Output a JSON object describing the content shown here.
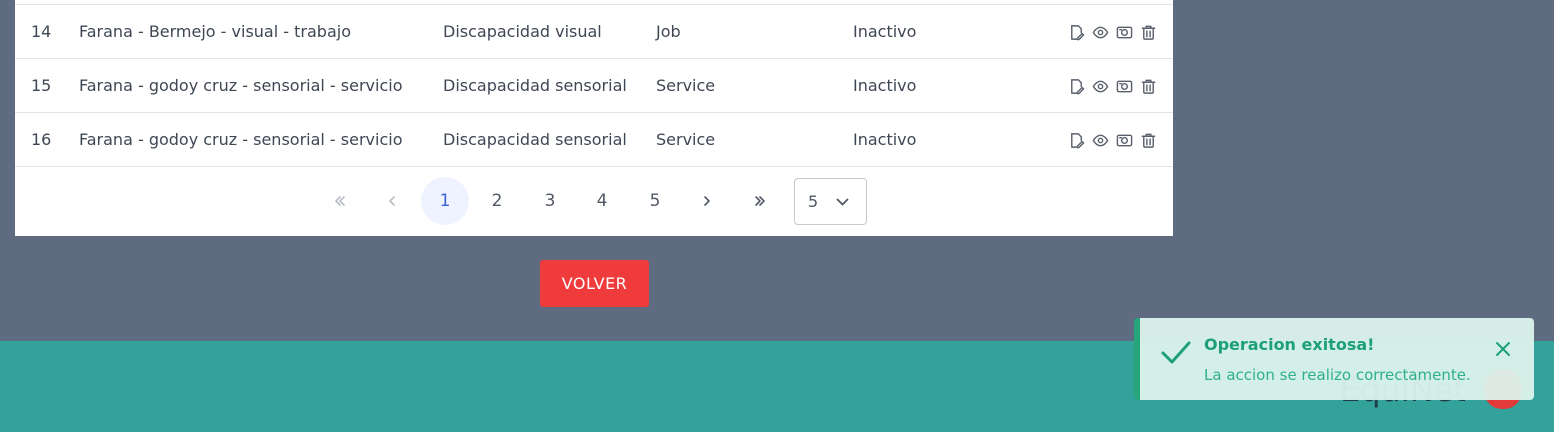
{
  "table": {
    "rows": [
      {
        "id": "14",
        "name": "Farana - Bermejo - visual - trabajo",
        "category": "Discapacidad visual",
        "type": "Job",
        "status": "Inactivo"
      },
      {
        "id": "15",
        "name": "Farana - godoy cruz - sensorial - servicio",
        "category": "Discapacidad sensorial",
        "type": "Service",
        "status": "Inactivo"
      },
      {
        "id": "16",
        "name": "Farana - godoy cruz - sensorial - servicio",
        "category": "Discapacidad sensorial",
        "type": "Service",
        "status": "Inactivo"
      }
    ],
    "action_icons": [
      "edit-icon",
      "eye-icon",
      "camera-icon",
      "trash-icon"
    ]
  },
  "pagination": {
    "pages": [
      "1",
      "2",
      "3",
      "4",
      "5"
    ],
    "current_page": "1",
    "rows_per_page": "5",
    "nav_icons": [
      "double-chevron-left-icon",
      "chevron-left-icon",
      "chevron-right-icon",
      "double-chevron-right-icon"
    ]
  },
  "actions": {
    "back_label": "VOLVER"
  },
  "footer": {
    "brand": "EquiNet"
  },
  "toast": {
    "title": "Operacion exitosa!",
    "message": "La accion se realizo correctamente.",
    "icon": "check-icon",
    "close_icon": "close-icon"
  },
  "colors": {
    "page_background": "#5f6b80",
    "footer_background": "#33a29b",
    "back_button": "#ef3b3b",
    "toast_accent": "#1ea077",
    "active_page": "#3b63d6"
  }
}
